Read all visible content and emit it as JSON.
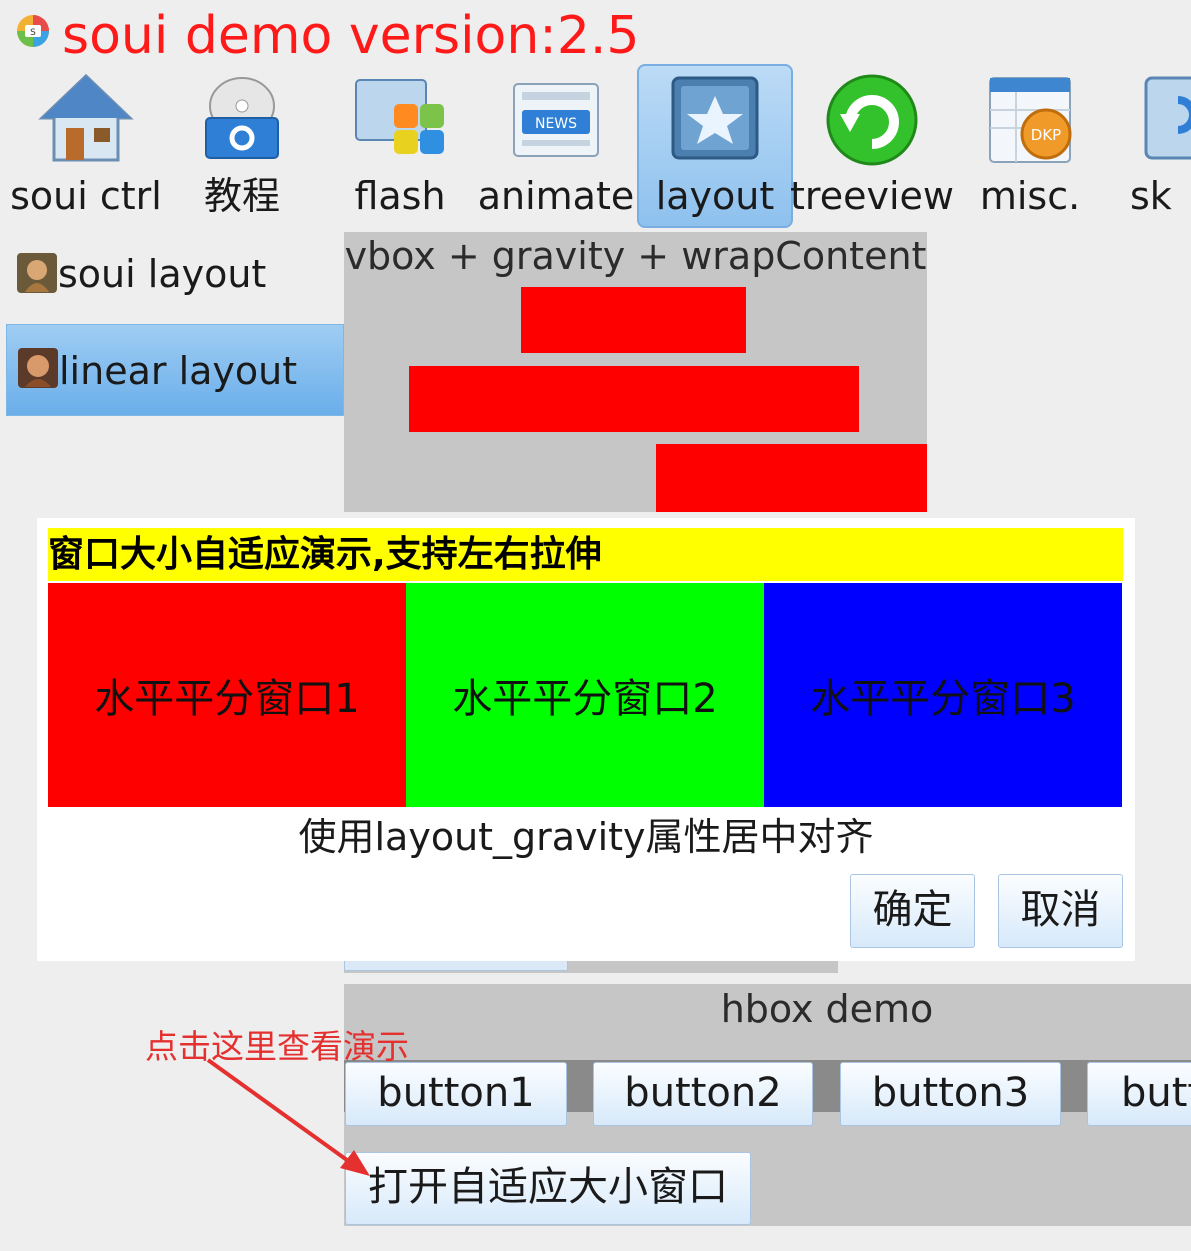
{
  "app": {
    "title": "soui demo version:2.5"
  },
  "toolbar": {
    "items": [
      {
        "label": "soui ctrl",
        "icon": "house-icon"
      },
      {
        "label": "教程",
        "icon": "settings-disc-icon"
      },
      {
        "label": "flash",
        "icon": "flash-tiles-icon"
      },
      {
        "label": "animate",
        "icon": "news-icon"
      },
      {
        "label": "layout",
        "icon": "layout-star-icon",
        "active": true
      },
      {
        "label": "treeview",
        "icon": "green-refresh-icon"
      },
      {
        "label": "misc.",
        "icon": "dkp-calendar-icon"
      },
      {
        "label": "sk",
        "icon": "skin-icon"
      }
    ]
  },
  "sidebar": {
    "items": [
      {
        "label": "soui layout",
        "icon": "avatar-icon"
      },
      {
        "label": "linear layout",
        "icon": "avatar-icon",
        "selected": true
      }
    ]
  },
  "vbox": {
    "title": "vbox + gravity + wrapContent"
  },
  "dialog": {
    "header": "窗口大小自适应演示,支持左右拉伸",
    "panes": [
      "水平平分窗口1",
      "水平平分窗口2",
      "水平平分窗口3"
    ],
    "caption": "使用layout_gravity属性居中对齐",
    "ok_label": "确定",
    "cancel_label": "取消"
  },
  "hbox": {
    "title": "hbox demo",
    "buttons": [
      "button1",
      "button2",
      "button3",
      "butt"
    ],
    "open_button": "打开自适应大小窗口"
  },
  "annotation": {
    "hint": "点击这里查看演示"
  },
  "colors": {
    "title": "#ff1a1a",
    "header_bg": "#ffff00",
    "pane1": "#ff0000",
    "pane2": "#00ff00",
    "pane3": "#0000ff",
    "hint": "#e53030"
  }
}
